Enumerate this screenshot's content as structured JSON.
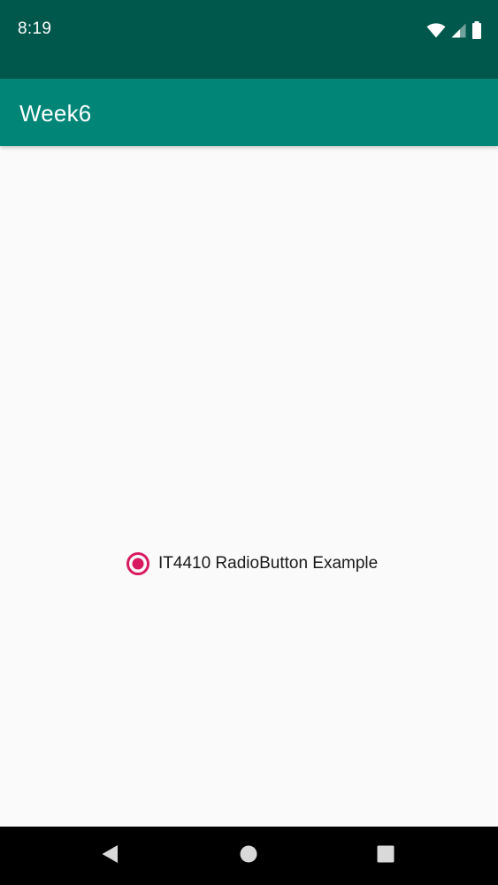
{
  "status_bar": {
    "time": "8:19",
    "icons": [
      "wifi-icon",
      "cell-signal-icon",
      "battery-icon"
    ],
    "background": "#00574b"
  },
  "app_bar": {
    "title": "Week6",
    "background": "#008577"
  },
  "radio": {
    "label": "IT4410 RadioButton Example",
    "checked": true,
    "accent_color": "#d81b60"
  },
  "nav_bar": {
    "buttons": [
      "back-icon",
      "home-icon",
      "recents-icon"
    ]
  }
}
